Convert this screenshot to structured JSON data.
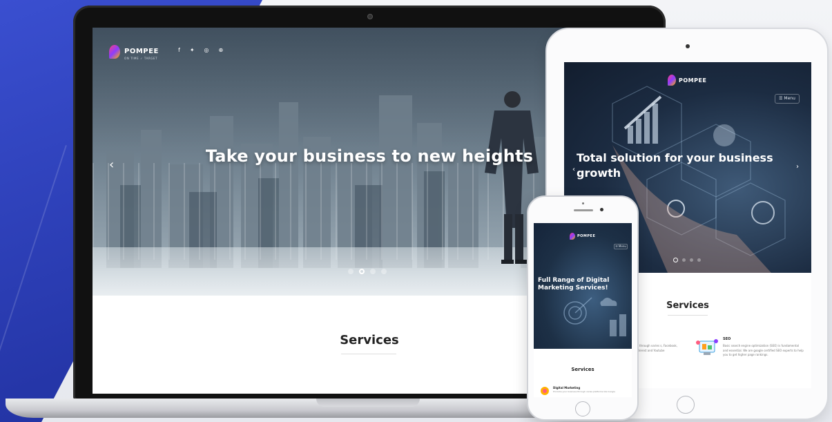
{
  "brand": {
    "name": "POMPEE",
    "name_suffix": "..",
    "tagline": "ON TIME ✓ TARGET",
    "logo_colors": [
      "#ff3d7f",
      "#8b3dff",
      "#ffb100"
    ]
  },
  "laptop": {
    "social_icons": [
      "facebook-icon",
      "twitter-icon",
      "instagram-icon",
      "pinterest-icon"
    ],
    "social_glyphs": [
      "f",
      "✦",
      "◎",
      "⊕"
    ],
    "headline": "Take your business to new heights",
    "prev_arrow": "‹",
    "slider_active_index": 1,
    "slider_count": 4,
    "services_title": "Services"
  },
  "tablet": {
    "menu_label": "☰ Menu",
    "headline": "Total solution for your business growth",
    "prev_arrow": "‹",
    "next_arrow": "›",
    "slider_active_index": 0,
    "slider_count": 4,
    "services_title": "Services",
    "seo_title": "SEO",
    "seo_text": "Basic search engine optimization (SEO) is fundamental and essential. We are google certified SEO experts to help you to get higher page rankings.",
    "col2_text": "ts through varies s, Facebook, interest and Youtube"
  },
  "phone": {
    "menu_label": "☰ Menu",
    "headline": "Full Range of Digital Marketing Services!",
    "services_title": "Services",
    "item_title": "Digital Marketing",
    "item_text": "Promote your business through varies platforms like Google"
  },
  "colors": {
    "accent_blue": "#2536a8",
    "hero_dark": "#1c2c42",
    "text_dark": "#222222"
  }
}
